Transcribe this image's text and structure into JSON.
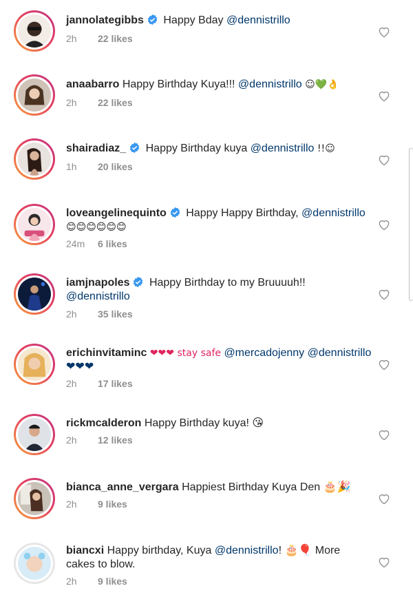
{
  "comments": [
    {
      "username": "jannolategibbs",
      "verified": true,
      "text_before": "Happy Bday ",
      "mention": "@dennistrillo",
      "text_after": "",
      "time": "2h",
      "likes": "22 likes"
    },
    {
      "username": "anaabarro",
      "verified": false,
      "text_before": "Happy Birthday Kuya!!! ",
      "mention": "@dennistrillo",
      "text_after": " ☺💚👌",
      "time": "2h",
      "likes": "22 likes"
    },
    {
      "username": "shairadiaz_",
      "verified": true,
      "text_before": "Happy Birthday kuya ",
      "mention": "@dennistrillo",
      "text_after": " !!☺",
      "time": "1h",
      "likes": "20 likes"
    },
    {
      "username": "loveangelinequinto",
      "verified": true,
      "text_before": "Happy Happy Birthday, ",
      "mention": "@dennistrillo",
      "text_after": " 😊😊😊😊😊😊",
      "time": "24m",
      "likes": "6 likes"
    },
    {
      "username": "iamjnapoles",
      "verified": true,
      "text_before": "Happy Birthday to my Bruuuuh!! ",
      "mention": "@dennistrillo",
      "text_after": "",
      "time": "2h",
      "likes": "35 likes"
    },
    {
      "username": "erichinvitaminc",
      "verified": false,
      "text_before": "❤❤❤ stay safe ",
      "mention": "@mercadojenny",
      "text_after": " @dennistrillo ❤❤❤",
      "time": "2h",
      "likes": "17 likes"
    },
    {
      "username": "rickmcalderon",
      "verified": false,
      "text_before": "Happy Birthday kuya! 😘",
      "mention": "",
      "text_after": "",
      "time": "2h",
      "likes": "12 likes"
    },
    {
      "username": "bianca_anne_vergara",
      "verified": false,
      "text_before": "Happiest Birthday Kuya Den 🎂🎉",
      "mention": "",
      "text_after": "",
      "time": "2h",
      "likes": "9 likes"
    },
    {
      "username": "biancxi",
      "verified": false,
      "text_before": "Happy birthday, Kuya ",
      "mention": "@dennistrillo",
      "text_after": "! 🎂🎈 More cakes to blow.",
      "time": "2h",
      "likes": "9 likes"
    }
  ],
  "colors": {
    "verified_blue": "#3897f0",
    "mention": "#00376b",
    "meta_gray": "#8e8e8e"
  }
}
